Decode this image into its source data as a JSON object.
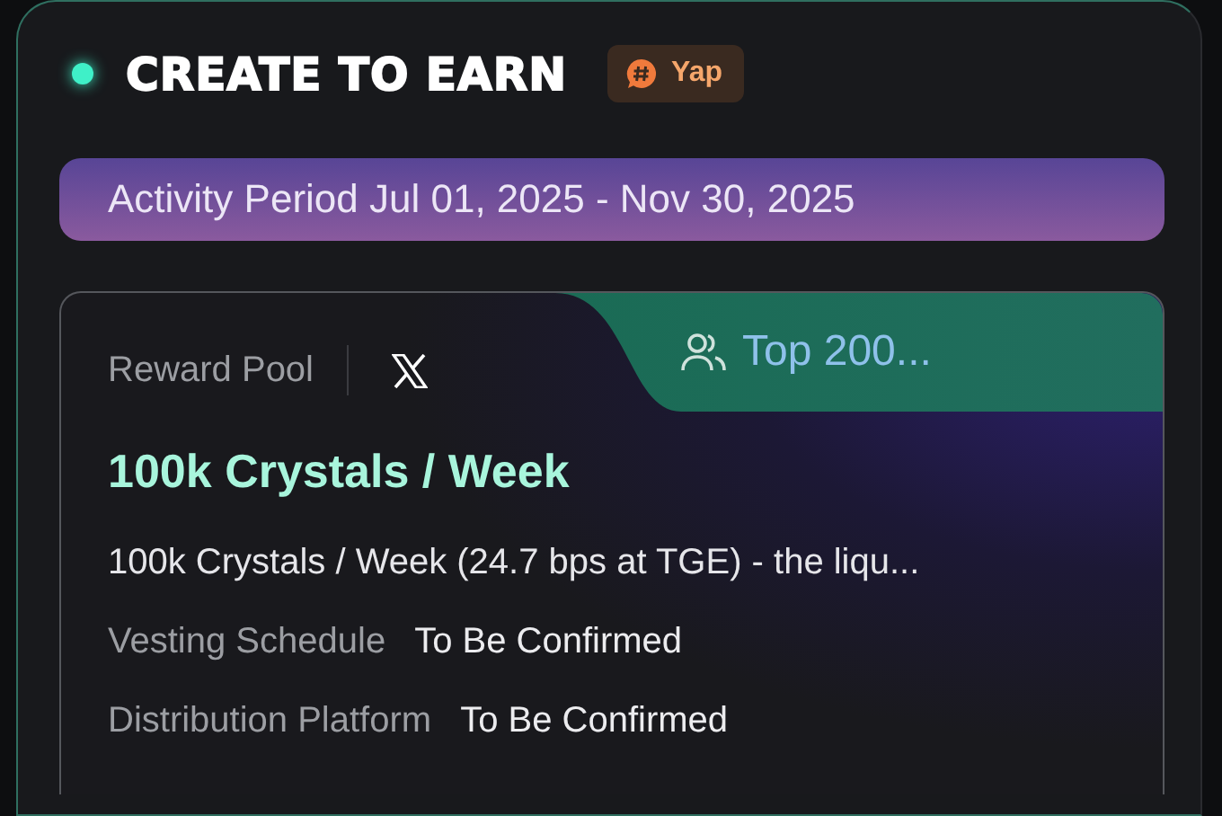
{
  "header": {
    "title": "CREATE TO EARN",
    "tag": "Yap"
  },
  "period": "Activity Period Jul 01, 2025 - Nov 30, 2025",
  "reward": {
    "label": "Reward Pool",
    "audience": "Top 200...",
    "amount": "100k Crystals / Week",
    "description": "100k Crystals / Week (24.7 bps at TGE) - the liqu...",
    "details": [
      {
        "label": "Vesting Schedule",
        "value": "To Be Confirmed"
      },
      {
        "label": "Distribution Platform",
        "value": "To Be Confirmed"
      }
    ]
  }
}
